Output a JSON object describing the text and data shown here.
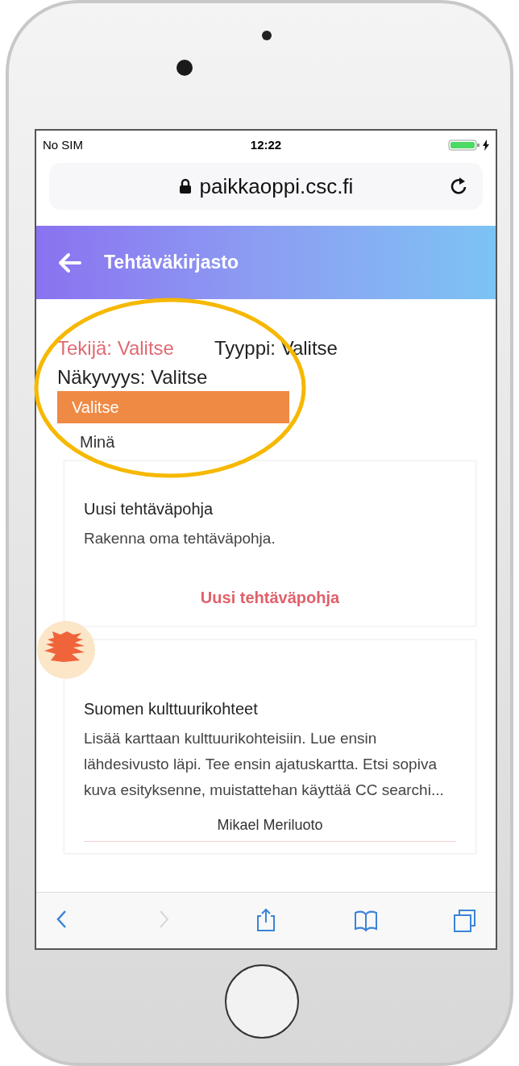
{
  "status_bar": {
    "carrier": "No SIM",
    "time": "12:22",
    "battery_charging": true
  },
  "browser": {
    "url": "paikkaoppi.csc.fi"
  },
  "app_bar": {
    "title": "Tehtäväkirjasto"
  },
  "filters": [
    {
      "label": "Tekijä: Valitse",
      "selected": true
    },
    {
      "label": "Tyyppi: Valitse",
      "selected": false
    },
    {
      "label": "Näkyvyys: Valitse",
      "selected": false
    }
  ],
  "dropdown": [
    {
      "label": "Valitse",
      "selected": true
    },
    {
      "label": "Minä",
      "selected": false
    }
  ],
  "cards": [
    {
      "kind": "new",
      "title": "Uusi tehtäväpohja",
      "description": "Rakenna oma tehtäväpohja.",
      "action": "Uusi tehtäväpohja"
    },
    {
      "kind": "task",
      "title": "Suomen kulttuurikohteet",
      "description": "Lisää karttaan kulttuurikohteisiin. Lue ensin lähdesivusto läpi. Tee ensin ajatuskartta. Etsi sopiva kuva esityksenne, muistattehan käyttää CC searchi...",
      "author": "Mikael Meriluoto"
    }
  ],
  "toolbar": [
    {
      "kind": "back",
      "disabled": false
    },
    {
      "kind": "forward",
      "disabled": true
    },
    {
      "kind": "share",
      "disabled": false
    },
    {
      "kind": "bookmarks",
      "disabled": false
    },
    {
      "kind": "tabs",
      "disabled": false
    }
  ]
}
